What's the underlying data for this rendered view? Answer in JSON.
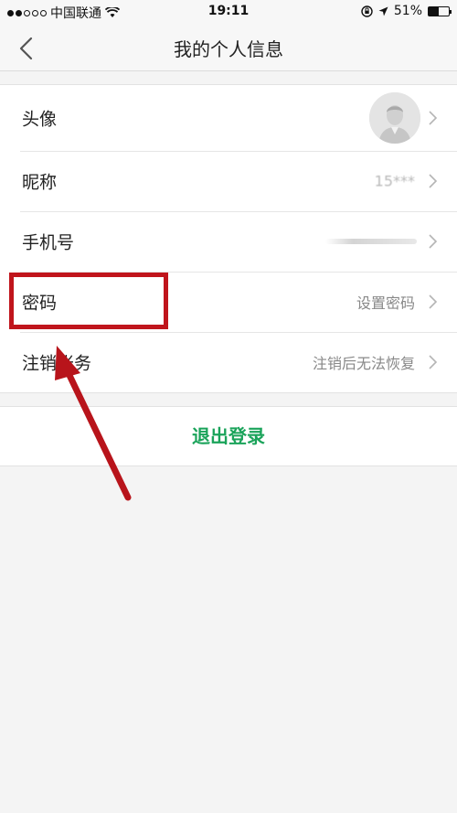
{
  "status_bar": {
    "carrier": "中国联通",
    "time": "19:11",
    "battery": "51%",
    "battery_level": 0.51
  },
  "nav": {
    "title": "我的个人信息"
  },
  "rows": [
    {
      "label": "头像",
      "value": ""
    },
    {
      "label": "昵称",
      "value": "15***"
    },
    {
      "label": "手机号",
      "value": ""
    },
    {
      "label": "密码",
      "value": "设置密码"
    },
    {
      "label": "注销账务",
      "value": "注销后无法恢复"
    }
  ],
  "logout": {
    "label": "退出登录"
  },
  "colors": {
    "accent": "#1aa35a",
    "annotation": "#c0151c"
  }
}
